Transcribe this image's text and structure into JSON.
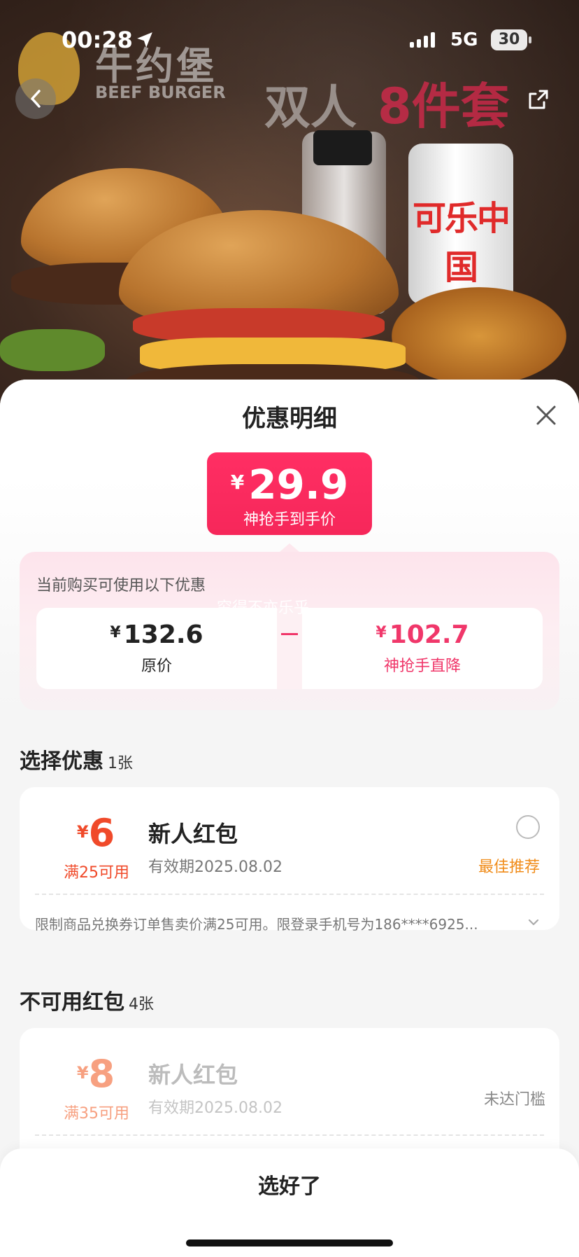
{
  "status_bar": {
    "time": "00:28",
    "network": "5G",
    "battery": "30"
  },
  "hero": {
    "brand_cn": "牛约堡",
    "brand_en": "BEEF BURGER",
    "promo_a": "双人",
    "promo_b": "8件套",
    "can_text": "可乐中国"
  },
  "sheet": {
    "title": "优惠明细",
    "price": {
      "currency": "¥",
      "value": "29.9",
      "label": "神抢手到手价"
    },
    "panel": {
      "label": "当前购买可使用以下优惠",
      "watermark": "穷得不亦乐乎",
      "original": {
        "currency": "¥",
        "value": "132.6",
        "label": "原价"
      },
      "discount": {
        "currency": "¥",
        "value": "102.7",
        "label": "神抢手直降"
      }
    },
    "choose_section": {
      "title": "选择优惠",
      "count": "1张"
    },
    "coupon_available": {
      "currency": "¥",
      "amount": "6",
      "condition": "满25可用",
      "name": "新人红包",
      "expiry": "有效期2025.08.02",
      "tag": "最佳推荐",
      "note": "限制商品兑换券订单售卖价满25可用。限登录手机号为186****6925..."
    },
    "unavailable_section": {
      "title": "不可用红包",
      "count": "4张"
    },
    "coupon_unavailable": {
      "currency": "¥",
      "amount": "8",
      "condition": "满35可用",
      "name": "新人红包",
      "expiry": "有效期2025.08.02",
      "status": "未达门槛"
    },
    "confirm_label": "选好了"
  },
  "colors": {
    "accent": "#f6275a",
    "coupon_orange": "#f04a2a",
    "best_tag": "#f08c1a"
  }
}
